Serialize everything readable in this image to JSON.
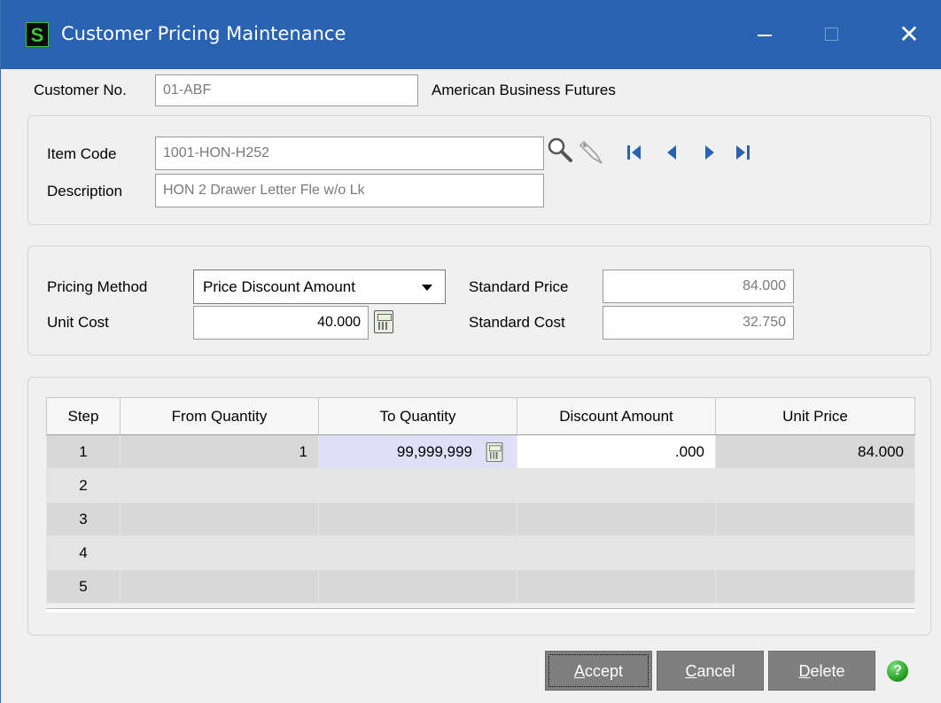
{
  "window": {
    "title": "Customer Pricing Maintenance",
    "logo_letter": "S",
    "close_glyph": "✕"
  },
  "customer": {
    "label": "Customer No.",
    "value": "01-ABF",
    "name": "American Business Futures"
  },
  "item": {
    "code_label": "Item Code",
    "code_value": "1001-HON-H252",
    "desc_label": "Description",
    "desc_value": "HON 2 Drawer Letter Fle w/o Lk"
  },
  "pricing": {
    "method_label": "Pricing Method",
    "method_value": "Price Discount Amount",
    "unit_cost_label": "Unit Cost",
    "unit_cost_value": "40.000",
    "std_price_label": "Standard Price",
    "std_price_value": "84.000",
    "std_cost_label": "Standard Cost",
    "std_cost_value": "32.750"
  },
  "grid": {
    "columns": [
      "Step",
      "From Quantity",
      "To Quantity",
      "Discount Amount",
      "Unit Price"
    ],
    "rows": [
      {
        "step": "1",
        "from": "1",
        "to": "99,999,999",
        "discount": ".000",
        "price": "84.000"
      },
      {
        "step": "2",
        "from": "",
        "to": "",
        "discount": "",
        "price": ""
      },
      {
        "step": "3",
        "from": "",
        "to": "",
        "discount": "",
        "price": ""
      },
      {
        "step": "4",
        "from": "",
        "to": "",
        "discount": "",
        "price": ""
      },
      {
        "step": "5",
        "from": "",
        "to": "",
        "discount": "",
        "price": ""
      }
    ]
  },
  "buttons": {
    "accept": {
      "prefix": "",
      "accel": "A",
      "rest": "ccept"
    },
    "cancel": {
      "prefix": "",
      "accel": "C",
      "rest": "ancel"
    },
    "delete": {
      "prefix": "",
      "accel": "D",
      "rest": "elete"
    },
    "help": "?"
  },
  "colors": {
    "titlebar": "#2a62b2",
    "button": "#7f7f7f",
    "selected_cell": "#dfe0f8"
  }
}
